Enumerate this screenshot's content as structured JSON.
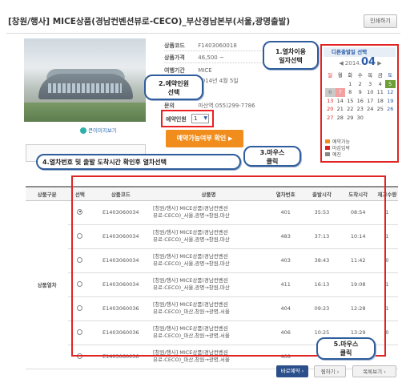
{
  "header": {
    "title": "[창원/행사] MICE상품(경남컨벤션뷰로-CECO)_부산경남본부(서울,광명출발)",
    "print_label": "인쇄하기"
  },
  "product": {
    "zoom_label": "큰이미지보기",
    "code_label": "상품코드",
    "code_value": "F1403060018",
    "price_label": "상품가격",
    "price_value": "46,500 ~",
    "trip_label": "여행기간",
    "trip_value": "MICE",
    "trip_date": "2014년 4월 5일",
    "inquiry_label": "문의",
    "inquiry_value": "마산역 055)299-7786",
    "count_label": "예약인원",
    "count_value": "1",
    "check_button": "예약가능여부 확인"
  },
  "calendar": {
    "heading": "디른출발일 선택",
    "year": "2014.",
    "month": "04",
    "weekdays": [
      "일",
      "월",
      "화",
      "수",
      "목",
      "금",
      "토"
    ],
    "rows": [
      [
        "",
        "",
        "1",
        "2",
        "3",
        "4",
        "5"
      ],
      [
        "6",
        "7",
        "8",
        "9",
        "10",
        "11",
        "12"
      ],
      [
        "13",
        "14",
        "15",
        "16",
        "17",
        "18",
        "19"
      ],
      [
        "20",
        "21",
        "22",
        "23",
        "24",
        "25",
        "26"
      ],
      [
        "27",
        "28",
        "29",
        "30",
        "",
        "",
        ""
      ]
    ],
    "legend": [
      "예약가능",
      "마감임박",
      "예진"
    ],
    "legend_colors": [
      "#f08d1c",
      "#d22",
      "#888"
    ]
  },
  "table": {
    "headers": [
      "상품구분",
      "선택",
      "상품코드",
      "상품명",
      "열차번호",
      "출발시각",
      "도착시각",
      "재고수량"
    ],
    "category": "상품열차",
    "rows": [
      {
        "code": "E1403060034",
        "name1": "[창원/행사] MICE상품(경남컨벤션",
        "name2": "뷰로-CECO)_서울,광명→창원,마산",
        "train": "401",
        "dep": "35:53",
        "arr": "08:54",
        "stock": "1"
      },
      {
        "code": "E1403060034",
        "name1": "[창원/행사] MICE상품(경남컨벤션",
        "name2": "뷰로-CECO)_서울,광명→창원,마산",
        "train": "483",
        "dep": "37:13",
        "arr": "10:14",
        "stock": "1"
      },
      {
        "code": "E1403060034",
        "name1": "[창원/행사] MICE상품(경남컨벤션",
        "name2": "뷰로-CECO)_서울,광명→창원,마산",
        "train": "403",
        "dep": "38:43",
        "arr": "11:42",
        "stock": "0"
      },
      {
        "code": "E1403060034",
        "name1": "[창원/행사] MICE상품(경남컨벤션",
        "name2": "뷰로-CECO)_서울,광명→창원,마산",
        "train": "411",
        "dep": "16:13",
        "arr": "19:08",
        "stock": "1"
      },
      {
        "code": "E1403060036",
        "name1": "[창원/행사] MICE상품(경남컨벤션",
        "name2": "뷰로-CECO)_마산,창원→광명,서울",
        "train": "404",
        "dep": "09:23",
        "arr": "12:28",
        "stock": "1"
      },
      {
        "code": "E1403060036",
        "name1": "[창원/행사] MICE상품(경남컨벤션",
        "name2": "뷰로-CECO)_마산,창원→광명,서울",
        "train": "406",
        "dep": "10:25",
        "arr": "13:29",
        "stock": "0"
      },
      {
        "code": "E1403060036",
        "name1": "[창원/행사] MICE상품(경남컨벤션",
        "name2": "뷰로-CECO)_마산,창원→광명,서울",
        "train": "408",
        "dep": "12:",
        "arr": "",
        "stock": ""
      }
    ]
  },
  "buttons": {
    "reserve": "바로예약",
    "cart": "찜하기",
    "list": "목록보기"
  },
  "callouts": {
    "c1_line1": "1.열차이용",
    "c1_line2": "일자선택",
    "c2_line1": "2.예약인원",
    "c2_line2": "선택",
    "c3_line1": "3.마우스",
    "c3_line2": "클릭",
    "c4": "4.열차번호 및 출발 도착시간 확인후 열차선택",
    "c5_line1": "5.마우스",
    "c5_line2": "클릭"
  }
}
